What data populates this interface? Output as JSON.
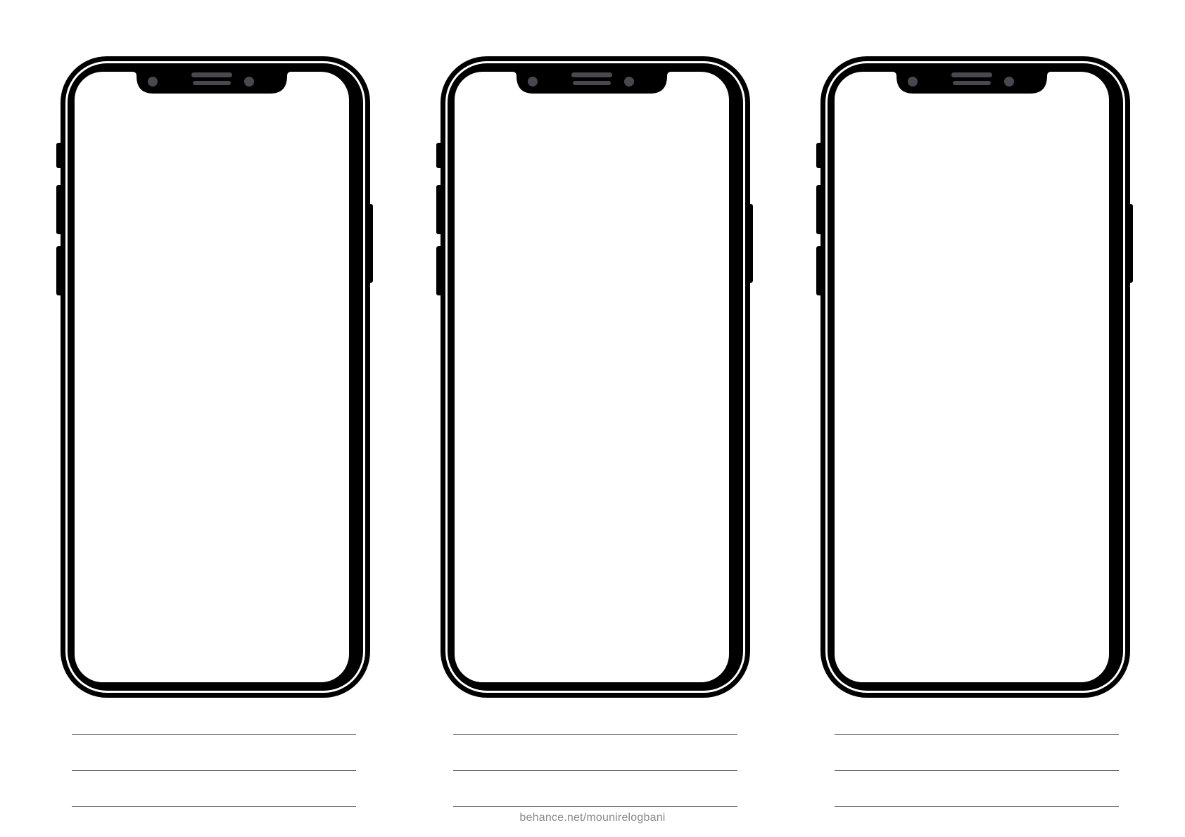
{
  "page": {
    "background": "#ffffff",
    "line_color": "#6a6a6a",
    "phone_color": "#000000",
    "notch_detail_color": "#4a4750"
  },
  "phones": [
    {
      "icon": "smartphone-frame-icon",
      "note_lines": 3
    },
    {
      "icon": "smartphone-frame-icon",
      "note_lines": 3
    },
    {
      "icon": "smartphone-frame-icon",
      "note_lines": 3
    }
  ],
  "footer": {
    "credit": "behance.net/mounirelogbani"
  }
}
